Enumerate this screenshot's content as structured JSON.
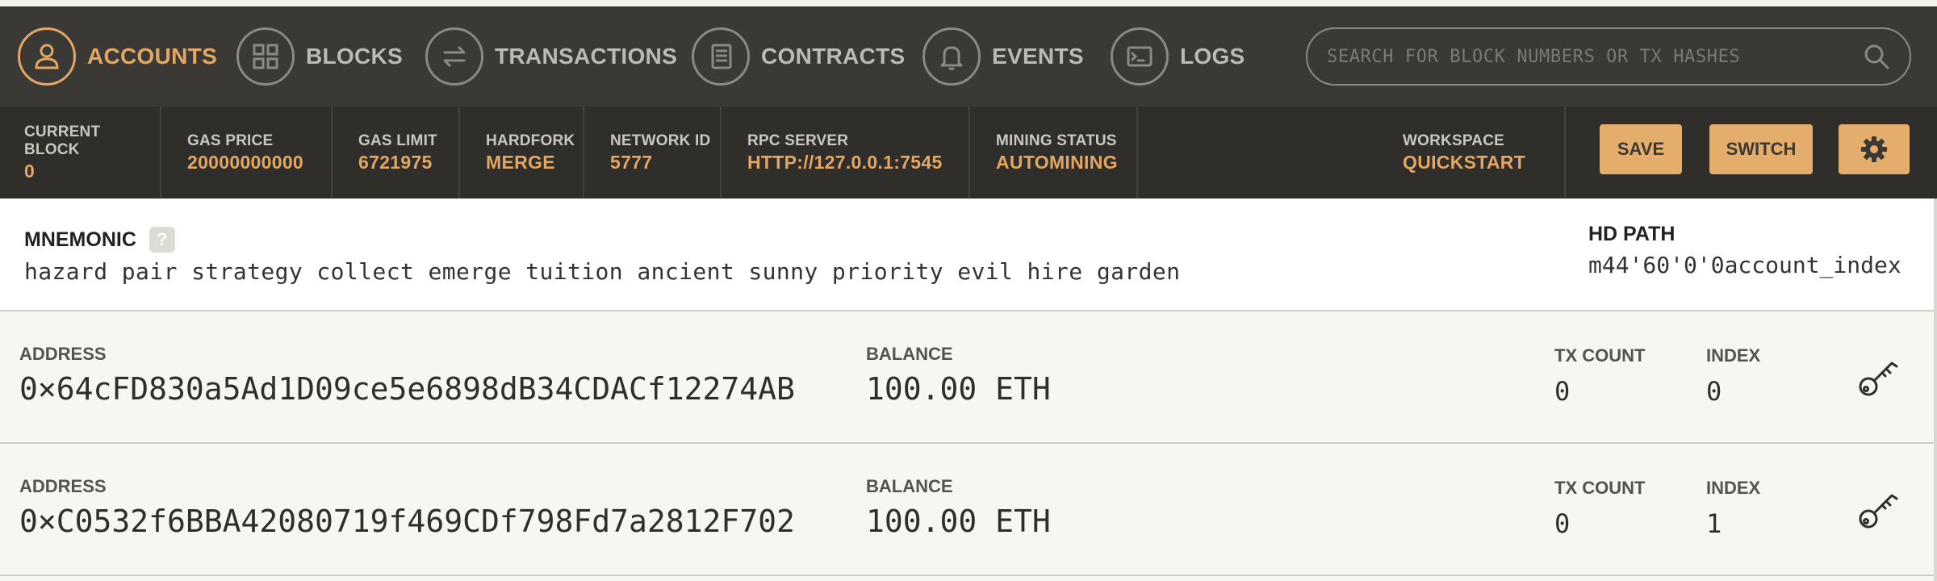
{
  "nav": {
    "items": [
      {
        "label": "ACCOUNTS",
        "icon": "user-icon",
        "active": true
      },
      {
        "label": "BLOCKS",
        "icon": "grid-icon",
        "active": false
      },
      {
        "label": "TRANSACTIONS",
        "icon": "arrows-exchange-icon",
        "active": false
      },
      {
        "label": "CONTRACTS",
        "icon": "document-icon",
        "active": false
      },
      {
        "label": "EVENTS",
        "icon": "bell-icon",
        "active": false
      },
      {
        "label": "LOGS",
        "icon": "terminal-icon",
        "active": false
      }
    ],
    "search_placeholder": "SEARCH FOR BLOCK NUMBERS OR TX HASHES"
  },
  "status": {
    "current_block": {
      "label": "CURRENT BLOCK",
      "value": "0"
    },
    "gas_price": {
      "label": "GAS PRICE",
      "value": "20000000000"
    },
    "gas_limit": {
      "label": "GAS LIMIT",
      "value": "6721975"
    },
    "hardfork": {
      "label": "HARDFORK",
      "value": "MERGE"
    },
    "network_id": {
      "label": "NETWORK ID",
      "value": "5777"
    },
    "rpc_server": {
      "label": "RPC SERVER",
      "value": "HTTP://127.0.0.1:7545"
    },
    "mining_status": {
      "label": "MINING STATUS",
      "value": "AUTOMINING"
    },
    "workspace": {
      "label": "WORKSPACE",
      "value": "QUICKSTART"
    },
    "save_label": "SAVE",
    "switch_label": "SWITCH"
  },
  "mnemonic": {
    "label": "MNEMONIC",
    "help": "?",
    "words": "hazard pair strategy collect emerge tuition ancient sunny priority evil hire garden",
    "hd_path_label": "HD PATH",
    "hd_path_value": "m44'60'0'0account_index"
  },
  "accounts": [
    {
      "address_label": "ADDRESS",
      "address": "0×64cFD830a5Ad1D09ce5e6898dB34CDACf12274AB",
      "balance_label": "BALANCE",
      "balance": "100.00 ETH",
      "tx_count_label": "TX COUNT",
      "tx_count": "0",
      "index_label": "INDEX",
      "index": "0"
    },
    {
      "address_label": "ADDRESS",
      "address": "0×C0532f6BBA42080719f469CDf798Fd7a2812F702",
      "balance_label": "BALANCE",
      "balance": "100.00 ETH",
      "tx_count_label": "TX COUNT",
      "tx_count": "0",
      "index_label": "INDEX",
      "index": "1"
    }
  ],
  "colors": {
    "accent": "#e4a663",
    "nav_bg": "#3b3935",
    "status_bg": "#2f2e2a",
    "muted": "#bcbab4"
  }
}
